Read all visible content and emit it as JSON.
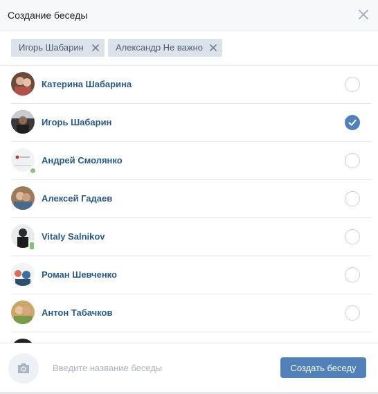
{
  "header": {
    "title": "Создание беседы"
  },
  "selected": [
    {
      "label": "Игорь Шабарин"
    },
    {
      "label": "Александр Не важно"
    }
  ],
  "contacts": [
    {
      "name": "Катерина Шабарина",
      "checked": false,
      "status": ""
    },
    {
      "name": "Игорь Шабарин",
      "checked": true,
      "status": ""
    },
    {
      "name": "Андрей Смолянко",
      "checked": false,
      "status": "online"
    },
    {
      "name": "Алексей Гадаев",
      "checked": false,
      "status": ""
    },
    {
      "name": "Vitaly Salnikov",
      "checked": false,
      "status": "mobile"
    },
    {
      "name": "Роман Шевченко",
      "checked": false,
      "status": ""
    },
    {
      "name": "Антон Табачков",
      "checked": false,
      "status": ""
    },
    {
      "name": "",
      "checked": false,
      "status": ""
    }
  ],
  "footer": {
    "input_placeholder": "Введите название беседы",
    "input_value": "",
    "create_label": "Создать беседу"
  },
  "colors": {
    "accent": "#5181b8",
    "link": "#2a5885",
    "chip_bg": "#dae2ea",
    "online": "#8ac176"
  },
  "icons": {
    "close": "close-icon",
    "remove": "remove-x-icon",
    "camera": "camera-icon",
    "check": "checkmark-icon"
  }
}
